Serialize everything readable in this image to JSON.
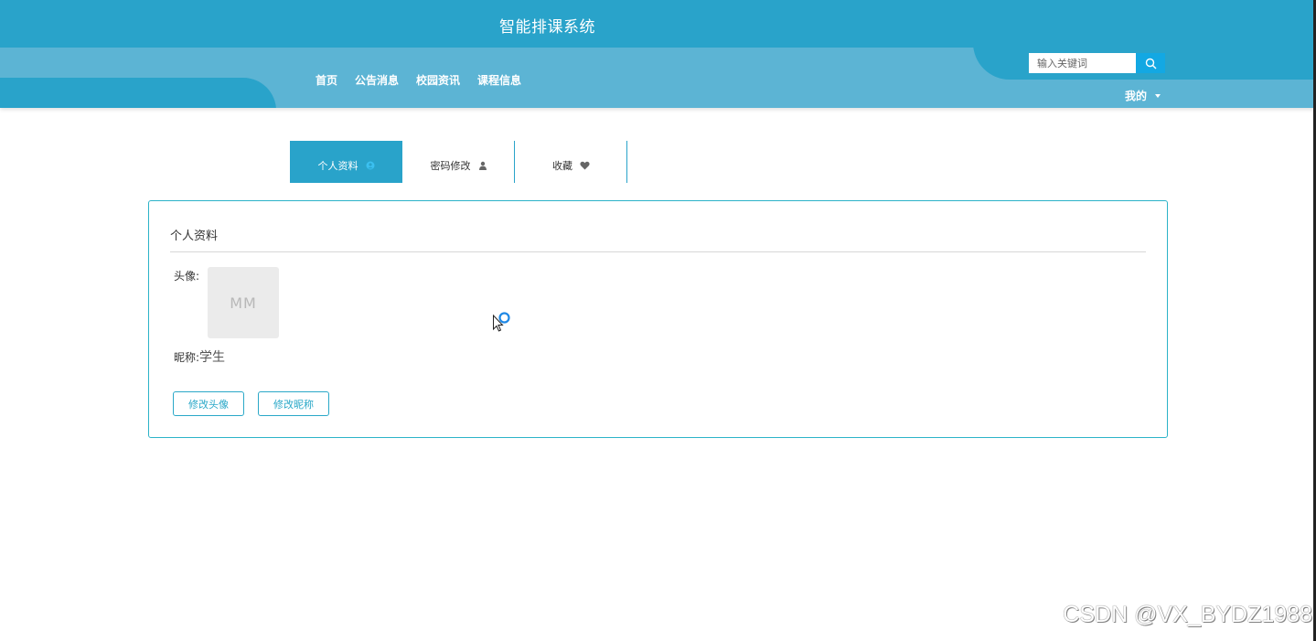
{
  "header": {
    "site_title": "智能排课系统",
    "nav": [
      {
        "label": "首页"
      },
      {
        "label": "公告消息"
      },
      {
        "label": "校园资讯"
      },
      {
        "label": "课程信息"
      }
    ],
    "search": {
      "placeholder": "输入关键词",
      "value": "",
      "icon": "search-icon"
    },
    "user_menu": {
      "label": "我的",
      "icon": "caret-down-icon"
    }
  },
  "tabs": [
    {
      "label": "个人资料",
      "icon": "user-circle-icon",
      "active": true
    },
    {
      "label": "密码修改",
      "icon": "person-icon",
      "active": false
    },
    {
      "label": "收藏",
      "icon": "heart-icon",
      "active": false
    }
  ],
  "profile": {
    "title": "个人资料",
    "avatar_label": "头像:",
    "avatar_placeholder": "MM",
    "nickname_label": "昵称:",
    "nickname_value": "学生",
    "buttons": {
      "change_avatar": "修改头像",
      "change_nickname": "修改昵称"
    }
  },
  "watermark": "CSDN @VX_BYDZ1988",
  "colors": {
    "header_dark": "#29a3ca",
    "header_light": "#5cb4d4",
    "accent": "#2aa8c8",
    "search_button": "#13a8e3"
  }
}
